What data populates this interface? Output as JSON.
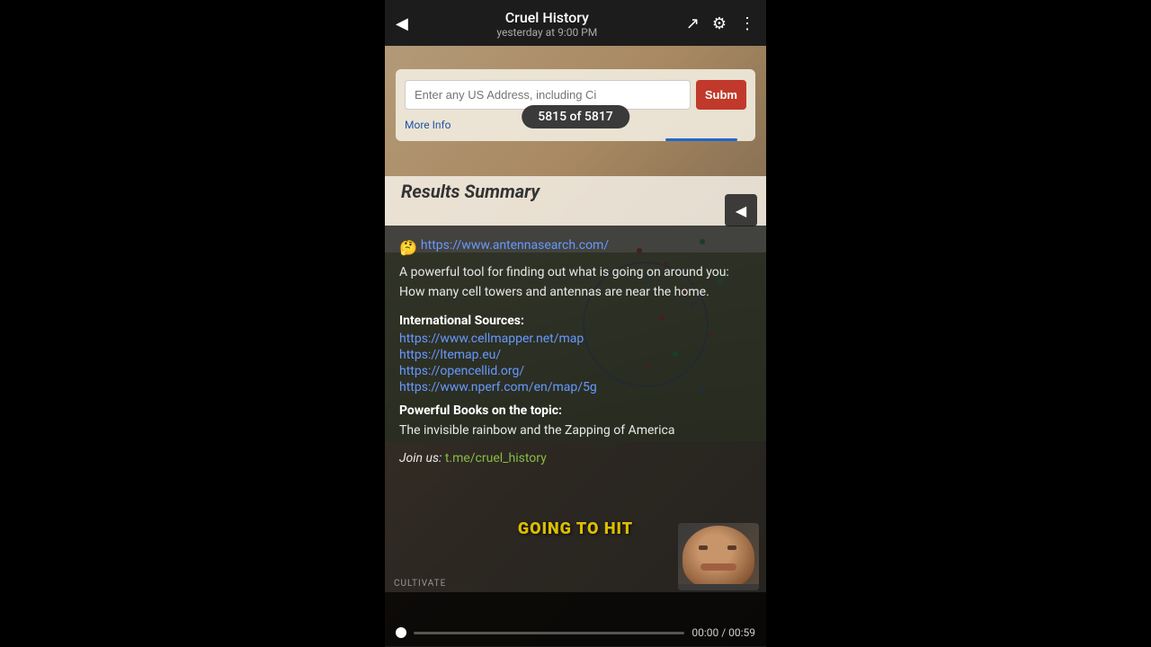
{
  "header": {
    "title": "Cruel History",
    "subtitle": "yesterday at 9:00 PM",
    "back_icon": "◀",
    "share_icon": "↗",
    "settings_icon": "⚙",
    "more_icon": "⋮"
  },
  "counter": {
    "label": "5815 of 5817"
  },
  "address_section": {
    "input_placeholder": "Enter any US Address, including Ci",
    "submit_label": "Subm",
    "more_info_label": "More Info"
  },
  "results_summary": {
    "label": "Results Summary"
  },
  "description": {
    "emoji": "🤔",
    "link": "https://www.antennasearch.com/",
    "body_text": "A powerful tool for finding out what is going on around you: How many cell towers and antennas are near the home.",
    "international_title": "International Sources:",
    "links": [
      "https://www.cellmapper.net/map",
      "https://ltemap.eu/",
      "https://opencellid.org/",
      "https://www.nperf.com/en/map/5g"
    ],
    "books_title": "Powerful Books on the topic:",
    "books_text": "The invisible rainbow and the Zapping of America",
    "join_label": "Join us:",
    "join_link": "t.me/cruel_history"
  },
  "overlay_text": {
    "going_to_hit": "GOING TO HIT",
    "cultivate": "CULTIVATE"
  },
  "video": {
    "current_time": "00:00",
    "total_time": "00:59",
    "time_display": "00:00 / 00:59"
  }
}
